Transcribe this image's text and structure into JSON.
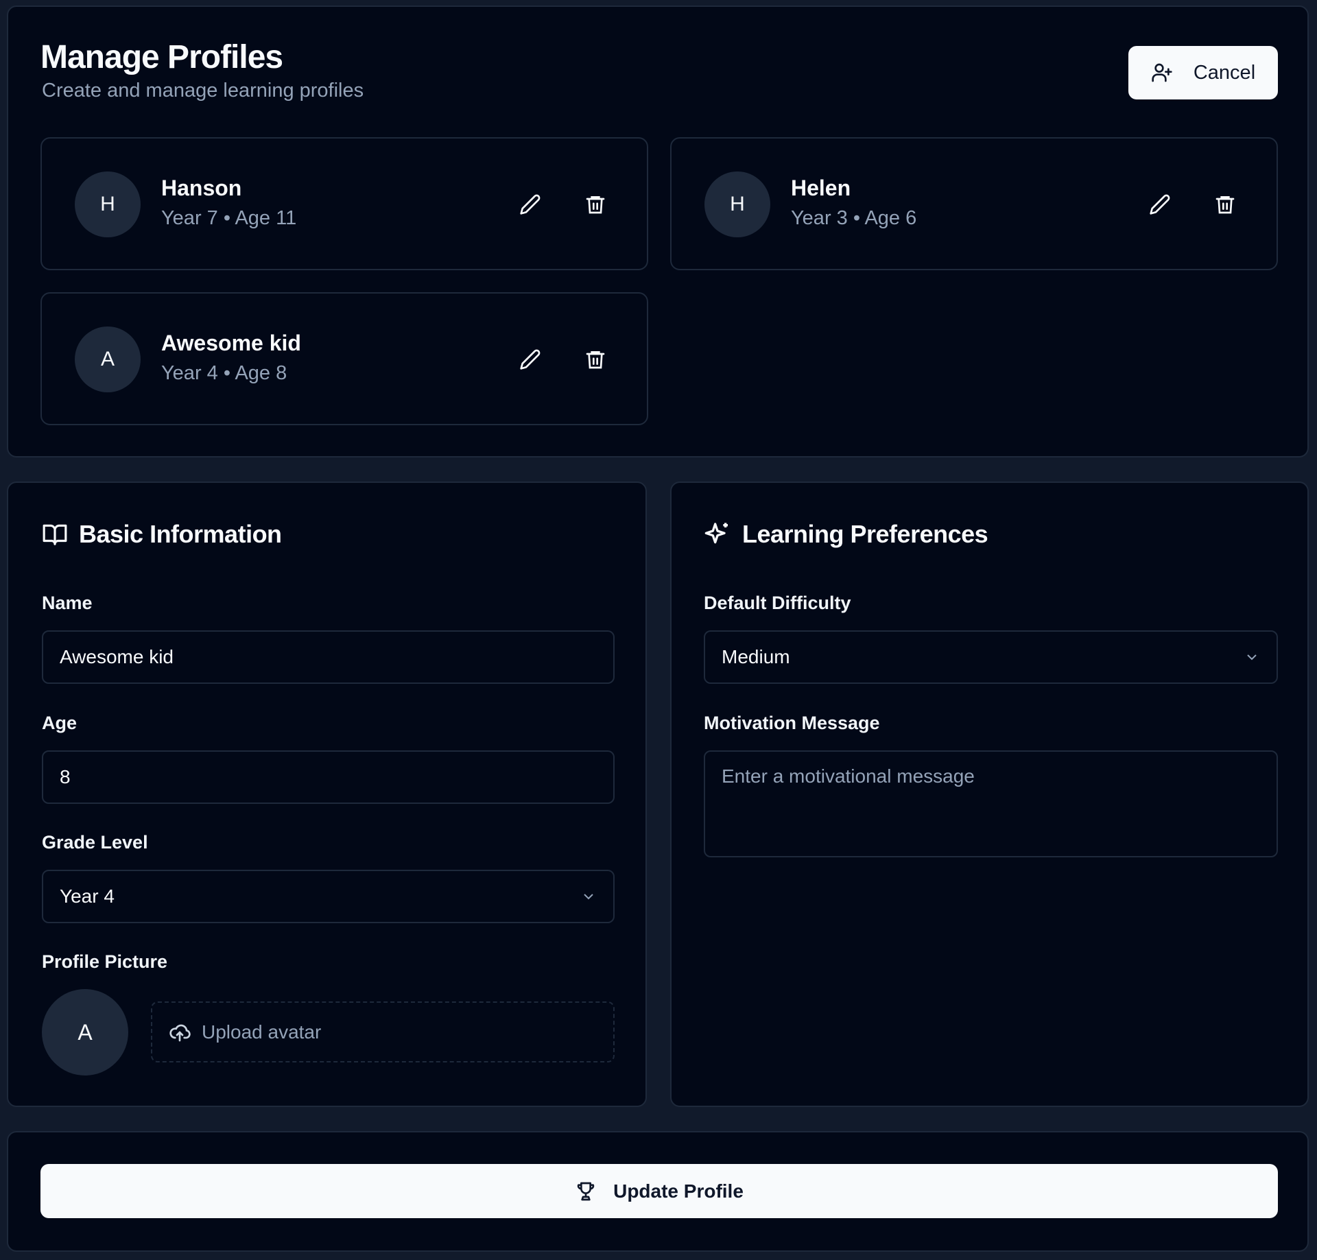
{
  "header": {
    "title": "Manage Profiles",
    "subtitle": "Create and manage learning profiles",
    "cancel_label": "Cancel"
  },
  "profiles": [
    {
      "initial": "H",
      "name": "Hanson",
      "meta": "Year 7 • Age 11"
    },
    {
      "initial": "H",
      "name": "Helen",
      "meta": "Year 3 • Age 6"
    },
    {
      "initial": "A",
      "name": "Awesome kid",
      "meta": "Year 4 • Age 8"
    }
  ],
  "basic": {
    "heading": "Basic Information",
    "name_label": "Name",
    "name_value": "Awesome kid",
    "age_label": "Age",
    "age_value": "8",
    "grade_label": "Grade Level",
    "grade_value": "Year 4",
    "picture_label": "Profile Picture",
    "avatar_initial": "A",
    "upload_label": "Upload avatar"
  },
  "prefs": {
    "heading": "Learning Preferences",
    "difficulty_label": "Default Difficulty",
    "difficulty_value": "Medium",
    "motivation_label": "Motivation Message",
    "motivation_placeholder": "Enter a motivational message"
  },
  "footer": {
    "update_label": "Update Profile"
  },
  "colors": {
    "background": "#111a2b",
    "panel": "#020817",
    "border": "#1e293b",
    "button": "#f8fafc"
  }
}
